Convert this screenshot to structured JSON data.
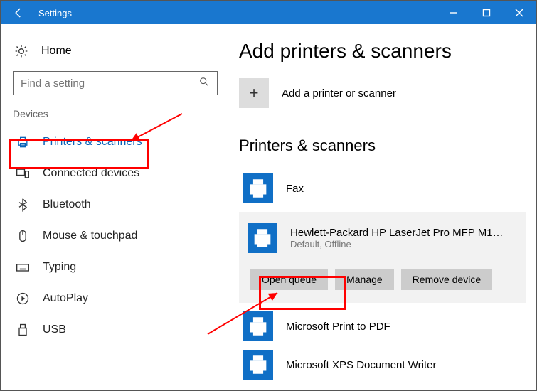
{
  "window": {
    "title": "Settings"
  },
  "sidebar": {
    "home": "Home",
    "search_placeholder": "Find a setting",
    "section": "Devices",
    "items": [
      {
        "label": "Printers & scanners"
      },
      {
        "label": "Connected devices"
      },
      {
        "label": "Bluetooth"
      },
      {
        "label": "Mouse & touchpad"
      },
      {
        "label": "Typing"
      },
      {
        "label": "AutoPlay"
      },
      {
        "label": "USB"
      }
    ]
  },
  "main": {
    "heading_add": "Add printers & scanners",
    "add_label": "Add a printer or scanner",
    "heading_list": "Printers & scanners",
    "printers": [
      {
        "name": "Fax",
        "status": ""
      },
      {
        "name": "Hewlett-Packard HP LaserJet Pro MFP M126...",
        "status": "Default, Offline"
      },
      {
        "name": "Microsoft Print to PDF",
        "status": ""
      },
      {
        "name": "Microsoft XPS Document Writer",
        "status": ""
      }
    ],
    "actions": {
      "open_queue": "Open queue",
      "manage": "Manage",
      "remove": "Remove device"
    }
  }
}
